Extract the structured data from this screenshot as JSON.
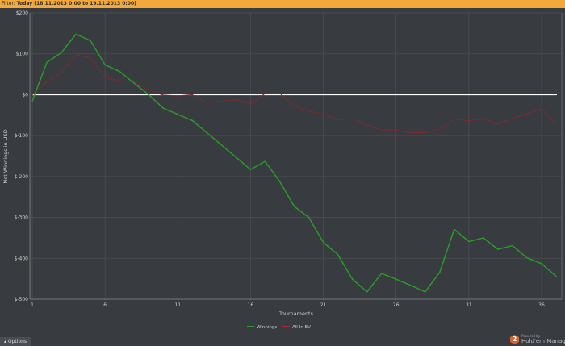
{
  "filter": {
    "label": "Filter:",
    "value": "Today (18.11.2013 0:00 to 19.11.2013 0:00)"
  },
  "options_button": {
    "icon": "triangle-up-icon",
    "label": "Options"
  },
  "logo": {
    "powered_by": "Powered by",
    "name": "Hold'em Manager",
    "badge": "2"
  },
  "colors": {
    "background": "#383b3f",
    "filter_bar": "#f3a83c",
    "winnings": "#2a9a2a",
    "allin_ev": "#7a2b2d",
    "zero_line": "#ffffff",
    "grid": "#4b4e52"
  },
  "chart_data": {
    "type": "line",
    "xlabel": "Tournaments",
    "ylabel": "Net Winnings in USD",
    "xlim": [
      1,
      37
    ],
    "ylim": [
      -500,
      200
    ],
    "x_ticks": [
      1,
      6,
      11,
      16,
      21,
      26,
      31,
      36
    ],
    "y_ticks": [
      200,
      100,
      0,
      -100,
      -200,
      -300,
      -400,
      -500
    ],
    "y_tick_labels": [
      "$200",
      "$100",
      "$0",
      "$-100",
      "$-200",
      "$-300",
      "$-400",
      "$-500"
    ],
    "grid": true,
    "legend_placement": "bottom",
    "x": [
      1,
      2,
      3,
      4,
      5,
      6,
      7,
      8,
      9,
      10,
      11,
      12,
      13,
      14,
      15,
      16,
      17,
      18,
      19,
      20,
      21,
      22,
      23,
      24,
      25,
      26,
      27,
      28,
      29,
      30,
      31,
      32,
      33,
      34,
      35,
      36,
      37
    ],
    "series": [
      {
        "name": "Winnings",
        "color": "#2a9a2a",
        "values": [
          -16,
          79,
          103,
          148,
          132,
          73,
          57,
          28,
          0,
          -33,
          -48,
          -63,
          -93,
          -123,
          -153,
          -183,
          -163,
          -212,
          -273,
          -300,
          -361,
          -391,
          -451,
          -482,
          -437,
          -451,
          -466,
          -482,
          -434,
          -329,
          -359,
          -350,
          -378,
          -369,
          -399,
          -413,
          -444
        ]
      },
      {
        "name": "All-In EV",
        "color": "#7a2b2d",
        "values": [
          0,
          31,
          54,
          98,
          90,
          42,
          34,
          32,
          11,
          -1,
          -3,
          0,
          -19,
          -16,
          -12,
          -22,
          3,
          4,
          -27,
          -40,
          -47,
          -62,
          -59,
          -74,
          -86,
          -86,
          -93,
          -93,
          -84,
          -59,
          -64,
          -58,
          -72,
          -57,
          -47,
          -34,
          -70
        ]
      }
    ]
  }
}
